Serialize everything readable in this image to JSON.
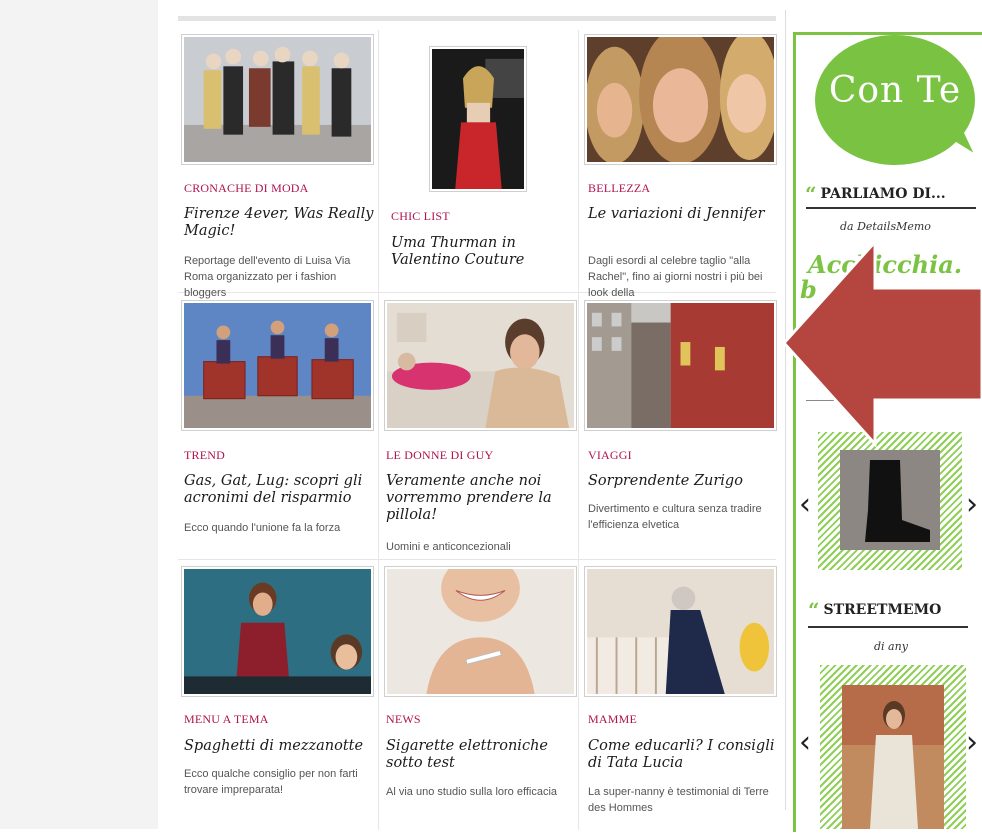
{
  "grid": [
    {
      "category": "CRONACHE DI MODA",
      "title": "Firenze 4ever, Was Really Magic!",
      "desc": "Reportage dell'evento di Luisa Via Roma organizzato per i fashion bloggers"
    },
    {
      "category": "CHIC LIST",
      "title": "Uma Thurman in Valentino Couture",
      "desc": ""
    },
    {
      "category": "BELLEZZA",
      "title": "Le variazioni di Jennifer",
      "desc": "Dagli esordi al celebre taglio \"alla Rachel\", fino ai giorni nostri i più bei look della"
    },
    {
      "category": "TREND",
      "title": "Gas, Gat, Lug: scopri gli acronimi del risparmio",
      "desc": "Ecco quando l'unione fa la forza"
    },
    {
      "category": "LE DONNE DI GUY",
      "title": "Veramente anche noi vorremmo prendere la pillola!",
      "desc": "Uomini e anticoncezionali"
    },
    {
      "category": "VIAGGI",
      "title": "Sorprendente Zurigo",
      "desc": "Divertimento e cultura senza tradire l'efficienza elvetica"
    },
    {
      "category": "MENU A TEMA",
      "title": "Spaghetti di mezzanotte",
      "desc": "Ecco qualche consiglio per non farti trovare impreparata!"
    },
    {
      "category": "NEWS",
      "title": "Sigarette elettroniche sotto test",
      "desc": "Al via uno studio sulla loro efficacia"
    },
    {
      "category": "MAMME",
      "title": "Come educarli? I consigli di Tata Lucia",
      "desc": "La super-nanny è testimonial di Terre des Hommes"
    }
  ],
  "sidebar": {
    "bubble_text": "Con Te",
    "section1_title": "PARLIAMO DI...",
    "section1_by": "da DetailsMemo",
    "section1_big": "Acchicchia.",
    "section1_big2": "b",
    "section2_title": "STREETMEMO",
    "section2_by": "di any",
    "prev_glyph": "‹",
    "next_glyph": "›"
  },
  "colors": {
    "accent_green": "#7cc243",
    "category_red": "#b0134e",
    "overlay_arrow": "#b5453f"
  },
  "icons": {
    "quote": "quote-icon",
    "prev": "chevron-left-icon",
    "next": "chevron-right-icon",
    "arrow": "big-left-arrow-icon"
  }
}
